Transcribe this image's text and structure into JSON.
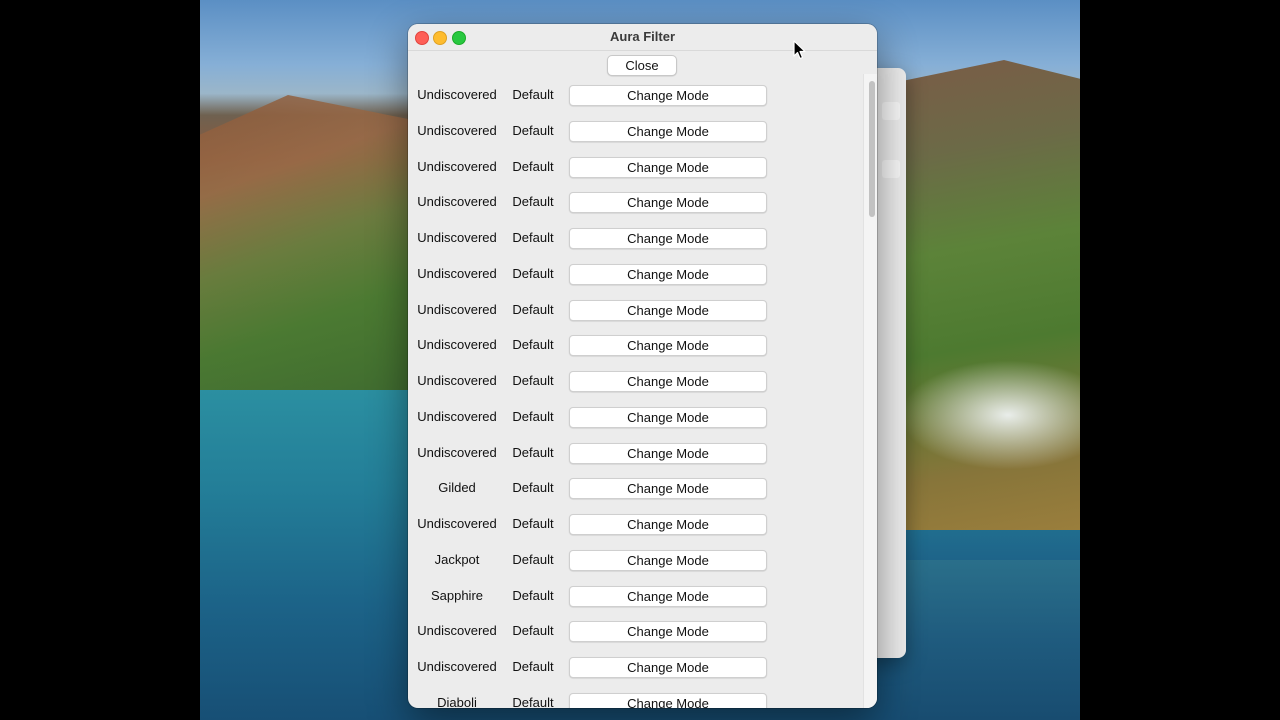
{
  "window": {
    "title": "Aura Filter",
    "close_label": "Close"
  },
  "rows": [
    {
      "aura": "Undiscovered",
      "mode": "Default",
      "action": "Change Mode"
    },
    {
      "aura": "Undiscovered",
      "mode": "Default",
      "action": "Change Mode"
    },
    {
      "aura": "Undiscovered",
      "mode": "Default",
      "action": "Change Mode"
    },
    {
      "aura": "Undiscovered",
      "mode": "Default",
      "action": "Change Mode"
    },
    {
      "aura": "Undiscovered",
      "mode": "Default",
      "action": "Change Mode"
    },
    {
      "aura": "Undiscovered",
      "mode": "Default",
      "action": "Change Mode"
    },
    {
      "aura": "Undiscovered",
      "mode": "Default",
      "action": "Change Mode"
    },
    {
      "aura": "Undiscovered",
      "mode": "Default",
      "action": "Change Mode"
    },
    {
      "aura": "Undiscovered",
      "mode": "Default",
      "action": "Change Mode"
    },
    {
      "aura": "Undiscovered",
      "mode": "Default",
      "action": "Change Mode"
    },
    {
      "aura": "Undiscovered",
      "mode": "Default",
      "action": "Change Mode"
    },
    {
      "aura": "Gilded",
      "mode": "Default",
      "action": "Change Mode"
    },
    {
      "aura": "Undiscovered",
      "mode": "Default",
      "action": "Change Mode"
    },
    {
      "aura": "Jackpot",
      "mode": "Default",
      "action": "Change Mode"
    },
    {
      "aura": "Sapphire",
      "mode": "Default",
      "action": "Change Mode"
    },
    {
      "aura": "Undiscovered",
      "mode": "Default",
      "action": "Change Mode"
    },
    {
      "aura": "Undiscovered",
      "mode": "Default",
      "action": "Change Mode"
    },
    {
      "aura": "Diaboli",
      "mode": "Default",
      "action": "Change Mode"
    }
  ],
  "colors": {
    "window_bg": "#ececec",
    "traffic_close": "#fe5f57",
    "traffic_minimize": "#febc2e",
    "traffic_maximize": "#28c840"
  },
  "icons": {
    "close": "close-icon",
    "minimize": "minimize-icon",
    "maximize": "maximize-icon",
    "cursor": "mouse-pointer-icon"
  }
}
